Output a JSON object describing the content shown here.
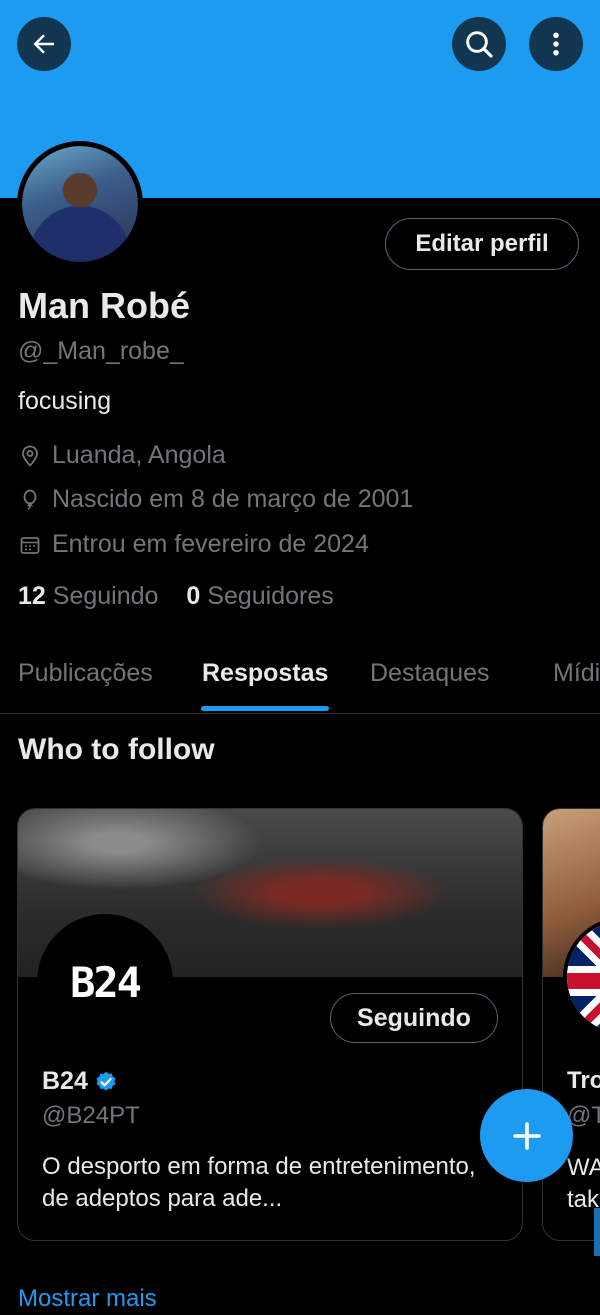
{
  "header": {
    "back_icon": "arrow-left-icon",
    "search_icon": "search-icon",
    "more_icon": "more-vertical-icon",
    "banner_color": "#1d9bf0"
  },
  "profile": {
    "edit_label": "Editar perfil",
    "name": "Man Robé",
    "handle": "@_Man_robe_",
    "bio": "focusing",
    "location": "Luanda,  Angola",
    "birth": "Nascido em 8 de março de 2001",
    "joined": "Entrou em fevereiro de 2024",
    "following_count": "12",
    "following_label": "Seguindo",
    "followers_count": "0",
    "followers_label": "Seguidores"
  },
  "tabs": [
    {
      "label": "Publicações",
      "active": false
    },
    {
      "label": "Respostas",
      "active": true
    },
    {
      "label": "Destaques",
      "active": false
    },
    {
      "label": "Mídia",
      "active": false
    }
  ],
  "who_to_follow": {
    "title": "Who to follow",
    "cards": [
      {
        "logo_text": "B24",
        "button": "Seguindo",
        "name": "B24",
        "verified": true,
        "handle": "@B24PT",
        "description": "O desporto em forma de entretenimento, de adeptos para ade..."
      },
      {
        "name": "Tro",
        "handle": "@T",
        "desc_line1": "WA",
        "desc_line2": "tak"
      }
    ],
    "show_more": "Mostrar mais"
  },
  "fab": {
    "icon": "plus-icon",
    "label": "+"
  }
}
